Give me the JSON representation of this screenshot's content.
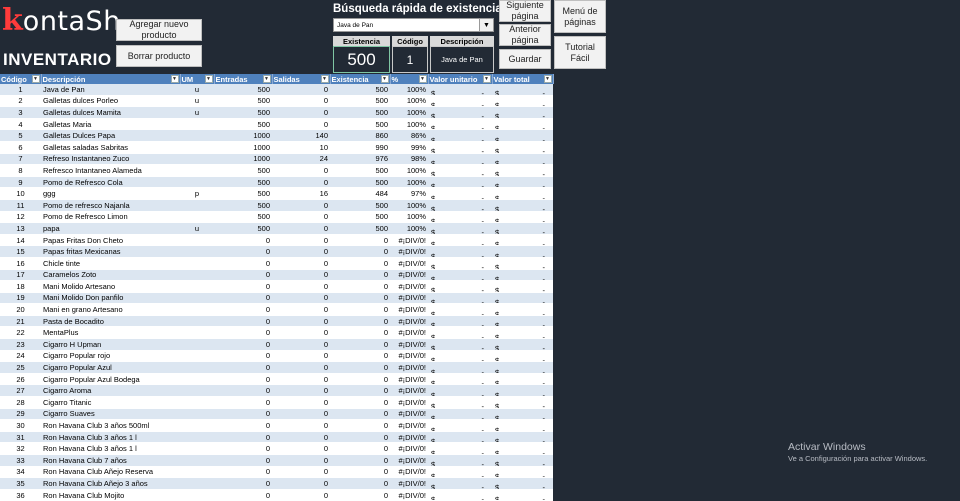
{
  "logo": {
    "first": "k",
    "rest": "ontaS",
    "tail": "h"
  },
  "title": "INVENTARIO",
  "buttons": {
    "add": "Agregar nuevo producto",
    "delete": "Borrar producto",
    "next": "Siguiente página",
    "prev": "Anterior página",
    "save": "Guardar",
    "menu": "Menú de páginas",
    "tutorial": "Tutorial Fácil"
  },
  "quick_search": {
    "title": "Búsqueda rápida de existencias",
    "selected": "Java de Pan",
    "headers": [
      "Existencia",
      "Código",
      "Descripción"
    ],
    "existencia": "500",
    "codigo": "1",
    "descripcion": "Java de Pan"
  },
  "table": {
    "headers": [
      "Código",
      "Descripción",
      "UM",
      "Entradas",
      "Salidas",
      "Existencia",
      "%",
      "Valor unitario",
      "Valor total"
    ],
    "rows": [
      [
        "1",
        "Java de Pan",
        "u",
        "500",
        "0",
        "500",
        "100%",
        "$",
        "-",
        "$",
        "-"
      ],
      [
        "2",
        "Galletas dulces Porleo",
        "u",
        "500",
        "0",
        "500",
        "100%",
        "$",
        "-",
        "$",
        "-"
      ],
      [
        "3",
        "Galletas dulces Mamita",
        "u",
        "500",
        "0",
        "500",
        "100%",
        "$",
        "-",
        "$",
        "-"
      ],
      [
        "4",
        "Galletas Maria",
        "",
        "500",
        "0",
        "500",
        "100%",
        "$",
        "-",
        "$",
        "-"
      ],
      [
        "5",
        "Galletas Dulces Papa",
        "",
        "1000",
        "140",
        "860",
        "86%",
        "$",
        "-",
        "$",
        "-"
      ],
      [
        "6",
        "Galletas saladas Sabritas",
        "",
        "1000",
        "10",
        "990",
        "99%",
        "$",
        "-",
        "$",
        "-"
      ],
      [
        "7",
        "Refreso Instantaneo Zuco",
        "",
        "1000",
        "24",
        "976",
        "98%",
        "$",
        "-",
        "$",
        "-"
      ],
      [
        "8",
        "Refresco Intantaneo Alameda",
        "",
        "500",
        "0",
        "500",
        "100%",
        "$",
        "-",
        "$",
        "-"
      ],
      [
        "9",
        "Pomo de Refresco Cola",
        "",
        "500",
        "0",
        "500",
        "100%",
        "$",
        "-",
        "$",
        "-"
      ],
      [
        "10",
        "ggg",
        "p",
        "500",
        "16",
        "484",
        "97%",
        "$",
        "-",
        "$",
        "-"
      ],
      [
        "11",
        "Pomo de refresco Najanla",
        "",
        "500",
        "0",
        "500",
        "100%",
        "$",
        "-",
        "$",
        "-"
      ],
      [
        "12",
        "Pomo de Refresco Limon",
        "",
        "500",
        "0",
        "500",
        "100%",
        "$",
        "-",
        "$",
        "-"
      ],
      [
        "13",
        "papa",
        "u",
        "500",
        "0",
        "500",
        "100%",
        "$",
        "-",
        "$",
        "-"
      ],
      [
        "14",
        "Papas Fritas Don Cheto",
        "",
        "0",
        "0",
        "0",
        "#¡DIV/0!",
        "$",
        "-",
        "$",
        "-"
      ],
      [
        "15",
        "Papas fritas Mexicanas",
        "",
        "0",
        "0",
        "0",
        "#¡DIV/0!",
        "$",
        "-",
        "$",
        "-"
      ],
      [
        "16",
        "Chicle tinte",
        "",
        "0",
        "0",
        "0",
        "#¡DIV/0!",
        "$",
        "-",
        "$",
        "-"
      ],
      [
        "17",
        "Caramelos Zoto",
        "",
        "0",
        "0",
        "0",
        "#¡DIV/0!",
        "$",
        "-",
        "$",
        "-"
      ],
      [
        "18",
        "Mani Molido Artesano",
        "",
        "0",
        "0",
        "0",
        "#¡DIV/0!",
        "$",
        "-",
        "$",
        "-"
      ],
      [
        "19",
        "Mani Molido Don panfilo",
        "",
        "0",
        "0",
        "0",
        "#¡DIV/0!",
        "$",
        "-",
        "$",
        "-"
      ],
      [
        "20",
        "Mani en grano Artesano",
        "",
        "0",
        "0",
        "0",
        "#¡DIV/0!",
        "$",
        "-",
        "$",
        "-"
      ],
      [
        "21",
        "Pasta de Bocadito",
        "",
        "0",
        "0",
        "0",
        "#¡DIV/0!",
        "$",
        "-",
        "$",
        "-"
      ],
      [
        "22",
        "MentaPlus",
        "",
        "0",
        "0",
        "0",
        "#¡DIV/0!",
        "$",
        "-",
        "$",
        "-"
      ],
      [
        "23",
        "Cigarro H Upman",
        "",
        "0",
        "0",
        "0",
        "#¡DIV/0!",
        "$",
        "-",
        "$",
        "-"
      ],
      [
        "24",
        "Cigarro Popular rojo",
        "",
        "0",
        "0",
        "0",
        "#¡DIV/0!",
        "$",
        "-",
        "$",
        "-"
      ],
      [
        "25",
        "Cigarro Popular Azul",
        "",
        "0",
        "0",
        "0",
        "#¡DIV/0!",
        "$",
        "-",
        "$",
        "-"
      ],
      [
        "26",
        "Cigarro Popular Azul Bodega",
        "",
        "0",
        "0",
        "0",
        "#¡DIV/0!",
        "$",
        "-",
        "$",
        "-"
      ],
      [
        "27",
        "Cigarro Aroma",
        "",
        "0",
        "0",
        "0",
        "#¡DIV/0!",
        "$",
        "-",
        "$",
        "-"
      ],
      [
        "28",
        "Cigarro Titanic",
        "",
        "0",
        "0",
        "0",
        "#¡DIV/0!",
        "$",
        "-",
        "$",
        "-"
      ],
      [
        "29",
        "Cigarro Suaves",
        "",
        "0",
        "0",
        "0",
        "#¡DIV/0!",
        "$",
        "-",
        "$",
        "-"
      ],
      [
        "30",
        "Ron Havana Club 3 años 500ml",
        "",
        "0",
        "0",
        "0",
        "#¡DIV/0!",
        "$",
        "-",
        "$",
        "-"
      ],
      [
        "31",
        "Ron Havana Club 3 años 1 l",
        "",
        "0",
        "0",
        "0",
        "#¡DIV/0!",
        "$",
        "-",
        "$",
        "-"
      ],
      [
        "32",
        "Ron Havana Club 3 años 1 l",
        "",
        "0",
        "0",
        "0",
        "#¡DIV/0!",
        "$",
        "-",
        "$",
        "-"
      ],
      [
        "33",
        "Ron Havana Club 7 años",
        "",
        "0",
        "0",
        "0",
        "#¡DIV/0!",
        "$",
        "-",
        "$",
        "-"
      ],
      [
        "34",
        "Ron Havana Club Añejo Reserva",
        "",
        "0",
        "0",
        "0",
        "#¡DIV/0!",
        "$",
        "-",
        "$",
        "-"
      ],
      [
        "35",
        "Ron Havana Club Añejo 3 años",
        "",
        "0",
        "0",
        "0",
        "#¡DIV/0!",
        "$",
        "-",
        "$",
        "-"
      ],
      [
        "36",
        "Ron Havana Club Mojito",
        "",
        "0",
        "0",
        "0",
        "#¡DIV/0!",
        "$",
        "-",
        "$",
        "-"
      ]
    ]
  },
  "watermark": {
    "line1": "Activar Windows",
    "line2": "Ve a Configuración para activar Windows."
  },
  "colors": {
    "background": "#222a35",
    "header": "#4f81bd",
    "band": "#dce6f1",
    "accent": "#ff3b3b"
  }
}
